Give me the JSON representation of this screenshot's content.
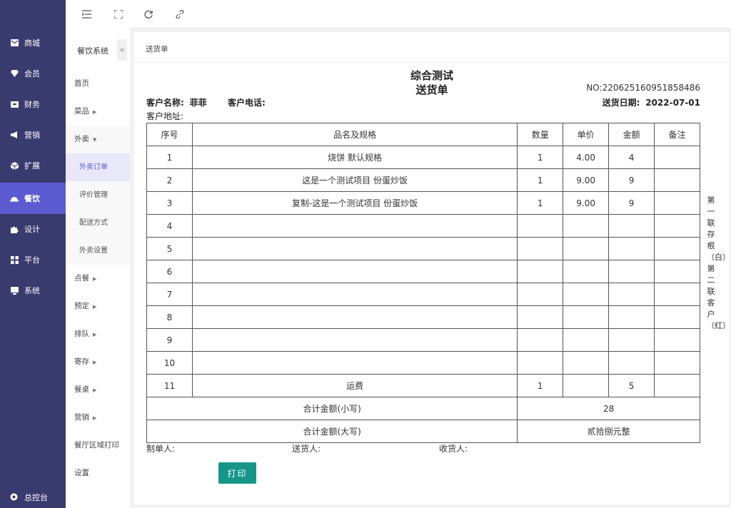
{
  "leftnav": [
    {
      "label": "商城",
      "icon": "mail-icon"
    },
    {
      "label": "会员",
      "icon": "diamond-icon"
    },
    {
      "label": "财务",
      "icon": "wallet-icon"
    },
    {
      "label": "营销",
      "icon": "megaphone-icon"
    },
    {
      "label": "扩展",
      "icon": "cube-icon"
    },
    {
      "label": "餐饮",
      "icon": "cloche-icon"
    },
    {
      "label": "设计",
      "icon": "puzzle-icon"
    },
    {
      "label": "平台",
      "icon": "grid-icon"
    },
    {
      "label": "系统",
      "icon": "monitor-icon"
    }
  ],
  "leftnav_bottom": {
    "label": "总控台",
    "icon": "gear-icon"
  },
  "subnav": {
    "title": "餐饮系统",
    "collapse": "«",
    "items": [
      "首页",
      "菜品",
      "外卖",
      "外卖订单",
      "评价管理",
      "配送方式",
      "外卖设置",
      "点餐",
      "预定",
      "排队",
      "寄存",
      "餐桌",
      "营销",
      "餐厅区域打印",
      "设置"
    ]
  },
  "breadcrumb": "送货单",
  "doc": {
    "title1": "综合测试",
    "title2": "送货单",
    "no": "NO:220625160951858486",
    "customer_name_label": "客户名称:",
    "customer_name": "菲菲",
    "customer_phone_label": "客户电话:",
    "delivery_date_label": "送货日期:",
    "delivery_date": "2022-07-01",
    "address_label": "客户地址:"
  },
  "table": {
    "headers": [
      "序号",
      "品名及规格",
      "数量",
      "单价",
      "金额",
      "备注"
    ],
    "rows": [
      [
        "1",
        "烧饼 默认规格",
        "1",
        "4.00",
        "4",
        ""
      ],
      [
        "2",
        "这是一个测试项目 份蛋炒饭",
        "1",
        "9.00",
        "9",
        ""
      ],
      [
        "3",
        "复制-这是一个测试项目 份蛋炒饭",
        "1",
        "9.00",
        "9",
        ""
      ],
      [
        "4",
        "",
        "",
        "",
        "",
        ""
      ],
      [
        "5",
        "",
        "",
        "",
        "",
        ""
      ],
      [
        "6",
        "",
        "",
        "",
        "",
        ""
      ],
      [
        "7",
        "",
        "",
        "",
        "",
        ""
      ],
      [
        "8",
        "",
        "",
        "",
        "",
        ""
      ],
      [
        "9",
        "",
        "",
        "",
        "",
        ""
      ],
      [
        "10",
        "",
        "",
        "",
        "",
        ""
      ],
      [
        "11",
        "运费",
        "1",
        "",
        "5",
        ""
      ]
    ],
    "total_small_label": "合计金额(小写)",
    "total_small": "28",
    "total_big_label": "合计金额(大写)",
    "total_big": "贰拾捌元整"
  },
  "side_text_1": "第一联存根（白）",
  "side_text_2": "第二联客户（红）",
  "signatures": {
    "maker": "制单人:",
    "deliverer": "送货人:",
    "receiver": "收货人:"
  },
  "print_button": "打印",
  "colors": {
    "sidebar": "#393a6e",
    "active": "#5a5bd0",
    "print": "#16968a"
  }
}
